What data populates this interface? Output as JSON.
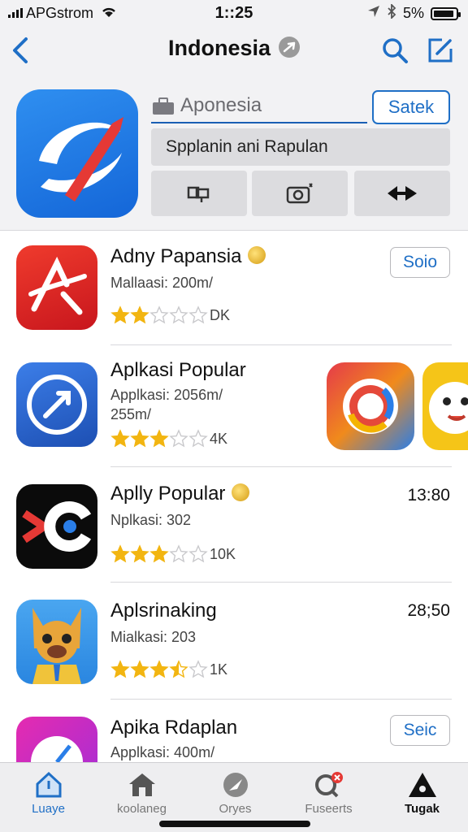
{
  "status_bar": {
    "carrier": "APGstrom",
    "time": "1::25",
    "battery": "5%"
  },
  "nav": {
    "title": "Indonesia",
    "back_icon": "chevron-left-icon",
    "search_icon": "search-icon",
    "edit_icon": "compose-icon"
  },
  "featured": {
    "search_placeholder": "Aponesia",
    "select_label": "Satek",
    "field_value": "Spplanin ani Rapulan",
    "actions": [
      "component-icon",
      "camera-icon",
      "share-arrows-icon"
    ]
  },
  "apps": [
    {
      "name": "Adny Papansia",
      "meta": "Mallaasi: 200m/",
      "rating": 2,
      "rating_count": "DK",
      "button": "Soio",
      "has_badge": true
    },
    {
      "name": "Aplkasi Popular",
      "meta": "Applkasi: 2056m/ 255m/",
      "rating": 3,
      "rating_count": "4K"
    },
    {
      "name": "Aplly Popular",
      "meta": "Nplkasi: 302",
      "rating": 3,
      "rating_count": "10K",
      "right_text": "13:80",
      "has_badge": true
    },
    {
      "name": "Aplsrinaking",
      "meta": "Mialkasi: 203",
      "rating": 3.5,
      "rating_count": "1K",
      "right_text": "28;50"
    },
    {
      "name": "Apika Rdaplan",
      "meta": "Applkasi: 400m/",
      "button": "Seic"
    }
  ],
  "tabs": [
    {
      "label": "Luaye",
      "icon": "home-outline-icon"
    },
    {
      "label": "koolaneg",
      "icon": "house-icon"
    },
    {
      "label": "Oryes",
      "icon": "compass-icon"
    },
    {
      "label": "Fuseerts",
      "icon": "search-alert-icon"
    },
    {
      "label": "Tugak",
      "icon": "triangle-logo-icon"
    }
  ],
  "colors": {
    "accent": "#1f6fc6",
    "star": "#f2b511",
    "background": "#f2f2f4"
  }
}
